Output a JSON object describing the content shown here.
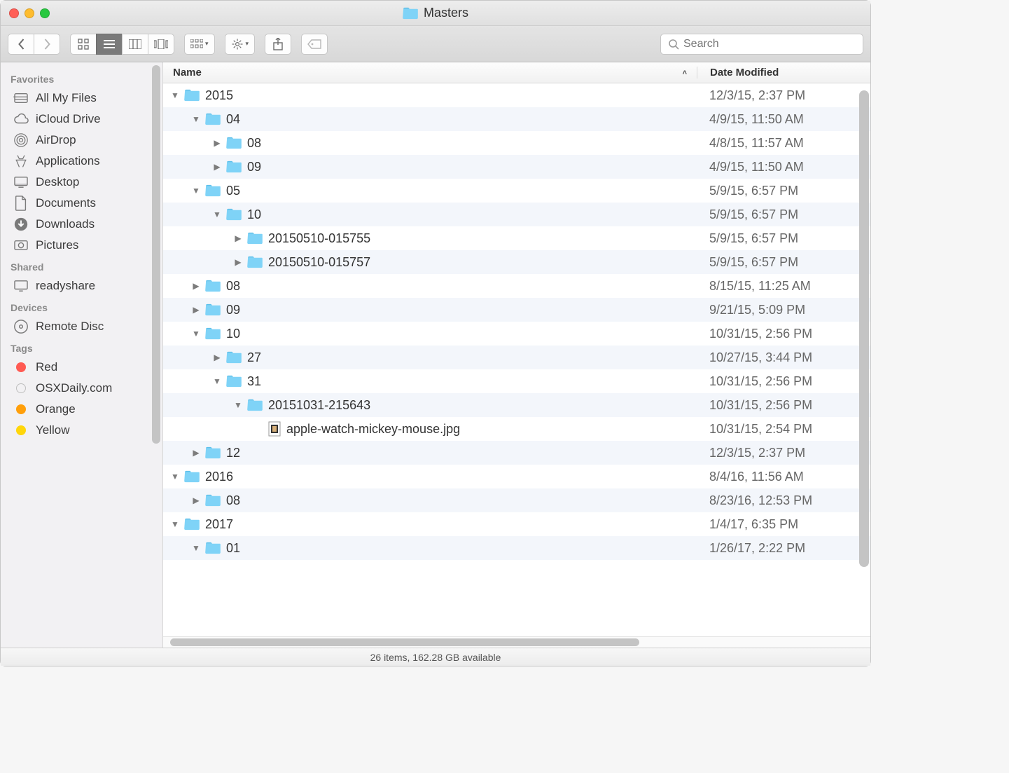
{
  "window": {
    "title": "Masters"
  },
  "toolbar": {
    "search_placeholder": "Search"
  },
  "columns": {
    "name": "Name",
    "date": "Date Modified"
  },
  "sidebar": {
    "sections": [
      {
        "heading": "Favorites",
        "items": [
          {
            "icon": "all-my-files",
            "label": "All My Files"
          },
          {
            "icon": "cloud",
            "label": "iCloud Drive"
          },
          {
            "icon": "airdrop",
            "label": "AirDrop"
          },
          {
            "icon": "apps",
            "label": "Applications"
          },
          {
            "icon": "desktop",
            "label": "Desktop"
          },
          {
            "icon": "documents",
            "label": "Documents"
          },
          {
            "icon": "downloads",
            "label": "Downloads"
          },
          {
            "icon": "pictures",
            "label": "Pictures"
          }
        ]
      },
      {
        "heading": "Shared",
        "items": [
          {
            "icon": "computer",
            "label": "readyshare"
          }
        ]
      },
      {
        "heading": "Devices",
        "items": [
          {
            "icon": "disc",
            "label": "Remote Disc"
          }
        ]
      },
      {
        "heading": "Tags",
        "items": [
          {
            "icon": "tag",
            "color": "#ff5a52",
            "label": "Red"
          },
          {
            "icon": "tag",
            "color": "#ffffff",
            "label": "OSXDaily.com",
            "hollow": true
          },
          {
            "icon": "tag",
            "color": "#ff9f0a",
            "label": "Orange"
          },
          {
            "icon": "tag",
            "color": "#ffd60a",
            "label": "Yellow"
          }
        ]
      }
    ]
  },
  "rows": [
    {
      "depth": 0,
      "type": "folder",
      "disclosure": "open",
      "name": "2015",
      "date": "12/3/15, 2:37 PM"
    },
    {
      "depth": 1,
      "type": "folder",
      "disclosure": "open",
      "name": "04",
      "date": "4/9/15, 11:50 AM"
    },
    {
      "depth": 2,
      "type": "folder",
      "disclosure": "closed",
      "name": "08",
      "date": "4/8/15, 11:57 AM"
    },
    {
      "depth": 2,
      "type": "folder",
      "disclosure": "closed",
      "name": "09",
      "date": "4/9/15, 11:50 AM"
    },
    {
      "depth": 1,
      "type": "folder",
      "disclosure": "open",
      "name": "05",
      "date": "5/9/15, 6:57 PM"
    },
    {
      "depth": 2,
      "type": "folder",
      "disclosure": "open",
      "name": "10",
      "date": "5/9/15, 6:57 PM"
    },
    {
      "depth": 3,
      "type": "folder",
      "disclosure": "closed",
      "name": "20150510-015755",
      "date": "5/9/15, 6:57 PM"
    },
    {
      "depth": 3,
      "type": "folder",
      "disclosure": "closed",
      "name": "20150510-015757",
      "date": "5/9/15, 6:57 PM"
    },
    {
      "depth": 1,
      "type": "folder",
      "disclosure": "closed",
      "name": "08",
      "date": "8/15/15, 11:25 AM"
    },
    {
      "depth": 1,
      "type": "folder",
      "disclosure": "closed",
      "name": "09",
      "date": "9/21/15, 5:09 PM"
    },
    {
      "depth": 1,
      "type": "folder",
      "disclosure": "open",
      "name": "10",
      "date": "10/31/15, 2:56 PM"
    },
    {
      "depth": 2,
      "type": "folder",
      "disclosure": "closed",
      "name": "27",
      "date": "10/27/15, 3:44 PM"
    },
    {
      "depth": 2,
      "type": "folder",
      "disclosure": "open",
      "name": "31",
      "date": "10/31/15, 2:56 PM"
    },
    {
      "depth": 3,
      "type": "folder",
      "disclosure": "open",
      "name": "20151031-215643",
      "date": "10/31/15, 2:56 PM"
    },
    {
      "depth": 4,
      "type": "file",
      "disclosure": "none",
      "name": "apple-watch-mickey-mouse.jpg",
      "date": "10/31/15, 2:54 PM"
    },
    {
      "depth": 1,
      "type": "folder",
      "disclosure": "closed",
      "name": "12",
      "date": "12/3/15, 2:37 PM"
    },
    {
      "depth": 0,
      "type": "folder",
      "disclosure": "open",
      "name": "2016",
      "date": "8/4/16, 11:56 AM"
    },
    {
      "depth": 1,
      "type": "folder",
      "disclosure": "closed",
      "name": "08",
      "date": "8/23/16, 12:53 PM"
    },
    {
      "depth": 0,
      "type": "folder",
      "disclosure": "open",
      "name": "2017",
      "date": "1/4/17, 6:35 PM"
    },
    {
      "depth": 1,
      "type": "folder",
      "disclosure": "open",
      "name": "01",
      "date": "1/26/17, 2:22 PM"
    }
  ],
  "status": {
    "text": "26 items, 162.28 GB available"
  }
}
